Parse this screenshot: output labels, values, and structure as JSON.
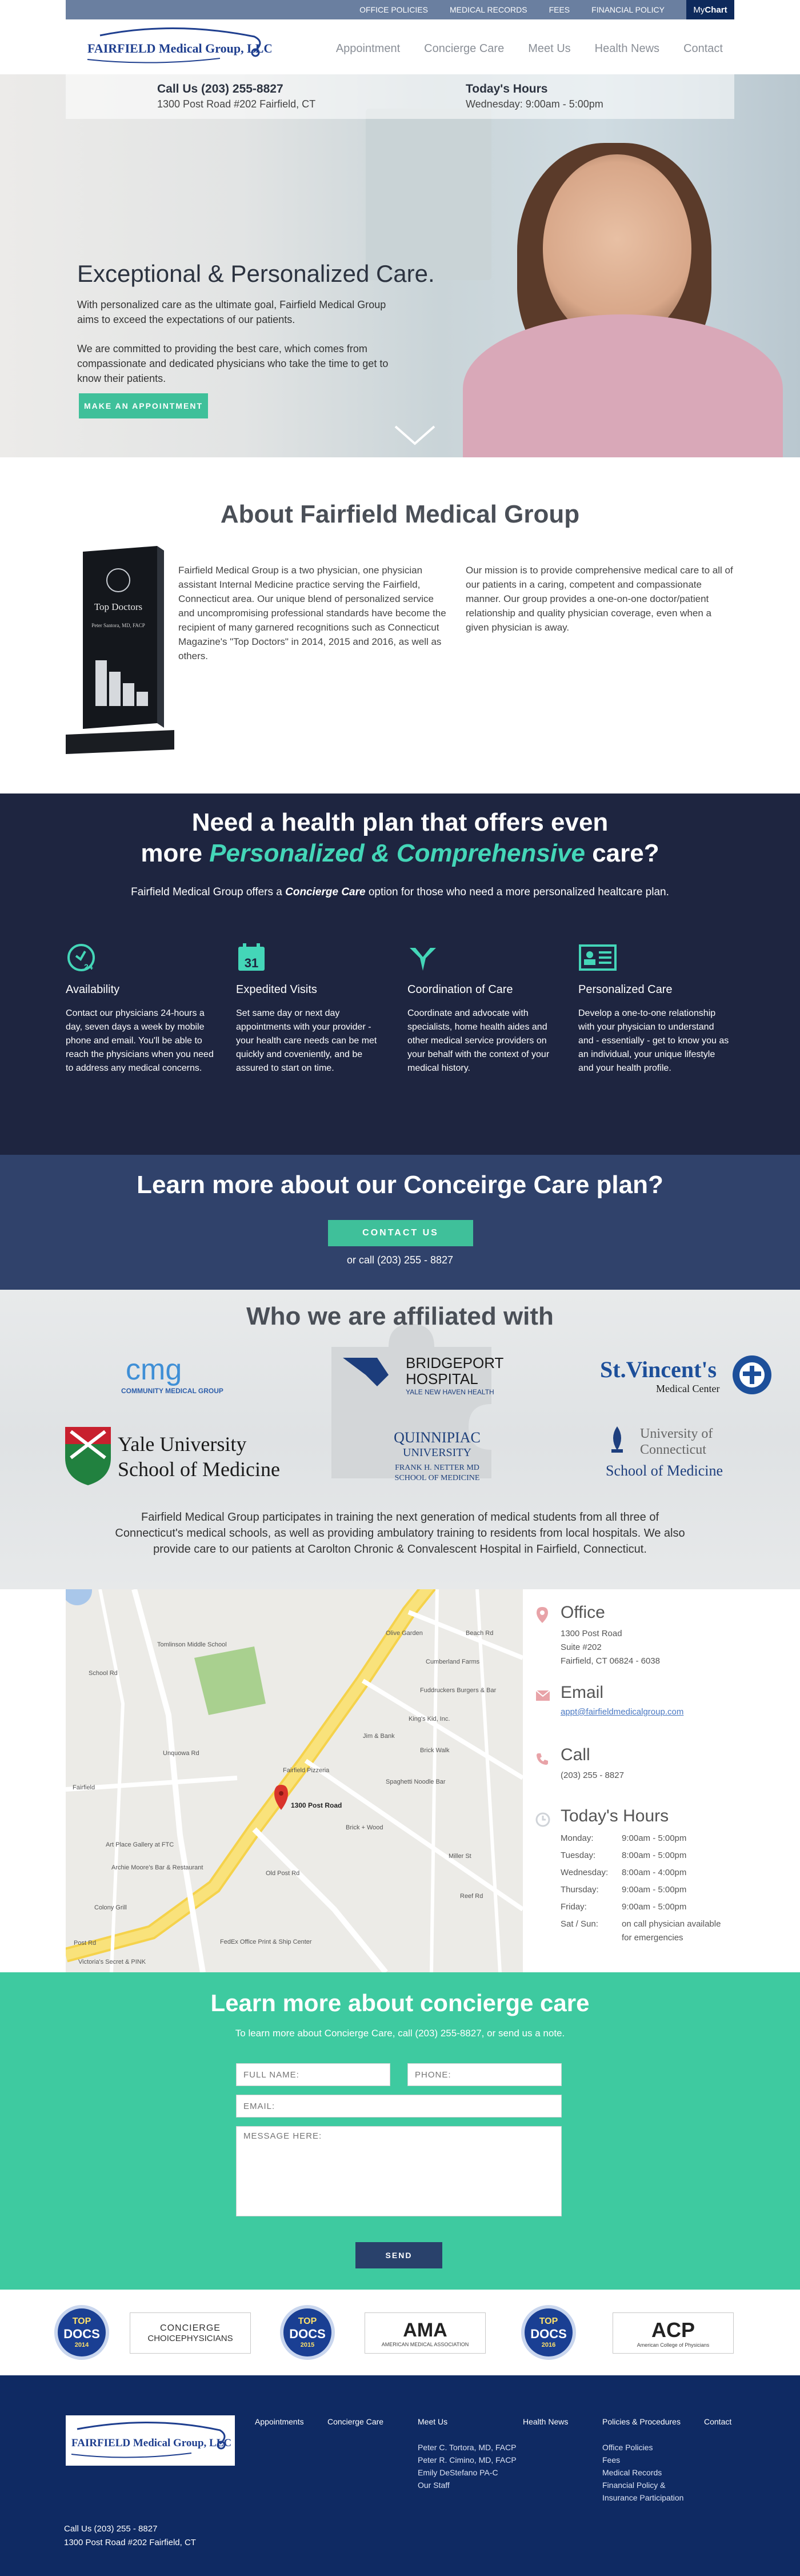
{
  "utility_bar": {
    "links": [
      "OFFICE POLICIES",
      "MEDICAL RECORDS",
      "FEES",
      "FINANCIAL POLICY"
    ],
    "mychart_prefix": "My",
    "mychart_bold": "Chart"
  },
  "header": {
    "logo_text": "FAIRFIELD Medical Group, LLC",
    "nav": [
      "Appointment",
      "Concierge Care",
      "Meet Us",
      "Health News",
      "Contact"
    ]
  },
  "hero": {
    "call_label": "Call Us (203) 255-8827",
    "address": "1300 Post Road #202 Fairfield, CT",
    "hours_label": "Today's Hours",
    "hours_value": "Wednesday: 9:00am - 5:00pm",
    "title": "Exceptional & Personalized Care.",
    "p1": "With personalized care as the ultimate goal, Fairfield Medical Group aims to exceed the expectations of our patients.",
    "p2": "We are committed to providing the best care, which comes from compassionate and dedicated physicians who take the time to get to know their patients.",
    "button": "MAKE AN APPOINTMENT",
    "chevron_icon": "chevron-down-icon"
  },
  "about": {
    "title": "About Fairfield Medical Group",
    "award_line1": "Top Doctors",
    "award_line2": "Peter Santora, MD, FACP",
    "left_text": "Fairfield Medical Group is a two physician, one physician assistant Internal Medicine practice serving the Fairfield, Connecticut area. Our unique blend of personalized service and uncompromising professional standards have become the recipient of many garnered recognitions such as Connecticut Magazine's \"Top Doctors\" in 2014, 2015 and 2016, as well as others.",
    "right_text": "Our mission is to provide comprehensive medical care to all of our patients in a caring, competent and compassionate manner. Our group provides a one-on-one doctor/patient relationship and quality physician coverage, even when a given physician is away."
  },
  "concierge": {
    "heading_line1": "Need a health plan that offers even",
    "heading_line2_pre": "more ",
    "heading_highlight": "Personalized & Comprehensive",
    "heading_line2_post": " care?",
    "sub_pre": "Fairfield Medical Group offers a ",
    "sub_bold": "Concierge Care",
    "sub_post": " option for those  who need a more personalized healtcare plan.",
    "features": [
      {
        "icon": "clock-24-icon",
        "title": "Availability",
        "desc": "Contact our physicians 24-hours a day, seven days a week by mobile phone and email. You'll be able to reach the physicians when you need to address any medical concerns."
      },
      {
        "icon": "calendar-icon",
        "title": "Expedited Visits",
        "desc": "Set same day or next day appointments with your provider - your health care needs can be met quickly and coveniently, and be assured to start on time."
      },
      {
        "icon": "merge-arrows-icon",
        "title": "Coordination of Care",
        "desc": "Coordinate and advocate with specialists, home health aides and other medical service providers on your behalf with the context of your medical history."
      },
      {
        "icon": "id-card-icon",
        "title": "Personalized Care",
        "desc": "Develop a one-to-one relationship with your physician to understand and - essentially - get to know you as an individual, your unique lifestyle and your health profile."
      }
    ],
    "accent": "#44d6b8"
  },
  "learn_more": {
    "title": "Learn more about our Conceirge Care plan?",
    "button": "CONTACT US",
    "call": "or call (203) 255 - 8827"
  },
  "affiliations": {
    "title": "Who we are affiliated with",
    "cmg_main": "cmg",
    "cmg_sub": "COMMUNITY MEDICAL GROUP",
    "bridgeport_1": "BRIDGEPORT",
    "bridgeport_2": "HOSPITAL",
    "bridgeport_3": "YALE NEW HAVEN HEALTH",
    "stv_1": "St.Vincent's",
    "stv_2": "Medical Center",
    "yale_1": "Yale University",
    "yale_2": "School of Medicine",
    "qu_1": "QUINNIPIAC",
    "qu_2": "UNIVERSITY",
    "qu_3": "FRANK H. NETTER MD",
    "qu_4": "SCHOOL OF MEDICINE",
    "uconn_1": "University of",
    "uconn_2": "Connecticut",
    "uconn_3": "School of Medicine",
    "text": "Fairfield Medical Group participates in training the next generation of medical students from all three of Connecticut's medical schools, as well as providing ambulatory training to residents from local hospitals. We also provide care to our patients at Carolton Chronic & Convalescent Hospital in Fairfield, Connecticut."
  },
  "map": {
    "pin_label": "1300 Post Road",
    "labels": {
      "tomlinson": "Tomlinson Middle School",
      "fairfield": "Fairfield",
      "art_place": "Art Place Gallery at FTC",
      "archie": "Archie Moore's Bar & Restaurant",
      "colony": "Colony Grill",
      "fedex": "FedEx Office Print & Ship Center",
      "victorias": "Victoria's Secret & PINK",
      "olive": "Olive Garden",
      "cumberland": "Cumberland Farms",
      "fuddruckers": "Fuddruckers Burgers & Bar",
      "kings": "King's Kid, Inc.",
      "jim": "Jim & Bank",
      "brick": "Brick Walk",
      "spaghetti": "Spaghetti Noodle Bar",
      "fairfield_pizza": "Fairfield Pizzeria",
      "brick_wood": "Brick + Wood",
      "post_rd": "Post Rd",
      "old_post_rd": "Old Post Rd",
      "reef_rd": "Reef Rd",
      "unquowa": "Unquowa Rd",
      "miller": "Miller St",
      "school_rd": "School Rd",
      "beach_rd": "Beach Rd"
    }
  },
  "info": {
    "office_title": "Office",
    "office_lines": [
      "1300 Post Road",
      "Suite #202",
      "Fairfield, CT 06824 - 6038"
    ],
    "email_title": "Email",
    "email": "appt@fairfieldmedicalgroup.com",
    "call_title": "Call",
    "phone": "(203) 255 - 8827",
    "hours_title": "Today's Hours",
    "hours": [
      {
        "day": "Monday:",
        "time": "9:00am - 5:00pm"
      },
      {
        "day": "Tuesday:",
        "time": "8:00am - 5:00pm"
      },
      {
        "day": "Wednesday:",
        "time": "8:00am - 4:00pm"
      },
      {
        "day": "Thursday:",
        "time": "9:00am - 5:00pm"
      },
      {
        "day": "Friday:",
        "time": "9:00am - 5:00pm"
      },
      {
        "day": "Sat / Sun:",
        "time": "on call physician available for emergencies"
      }
    ]
  },
  "form": {
    "title": "Learn more about concierge care",
    "sub": "To learn more about Concierge Care, call (203) 255-8827, or send us a note.",
    "name_ph": "FULL NAME:",
    "phone_ph": "PHONE:",
    "email_ph": "EMAIL:",
    "msg_ph": "MESSAGE HERE:",
    "send": "SEND"
  },
  "badges": {
    "topdocs_1": "TOP",
    "topdocs_2": "DOCS",
    "topdocs_year1": "2014",
    "topdocs_year2": "2015",
    "topdocs_year3": "2016",
    "concierge_1": "CONCIERGE",
    "concierge_2": "CHOICEPHYSICIANS",
    "ama": "AMA",
    "ama_sub": "AMERICAN MEDICAL ASSOCIATION",
    "acp": "ACP",
    "acp_sub": "American College of Physicians"
  },
  "footer": {
    "logo_text": "FAIRFIELD Medical Group, LLC",
    "contact_1": "Call Us (203) 255 - 8827",
    "contact_2": "1300 Post Road #202 Fairfield, CT",
    "cols": [
      {
        "h": "Appointments",
        "items": []
      },
      {
        "h": "Concierge Care",
        "items": []
      },
      {
        "h": "Meet Us",
        "items": [
          "Peter C. Tortora, MD, FACP",
          "Peter R. Cimino, MD, FACP",
          "Emily DeStefano PA-C",
          "Our Staff"
        ]
      },
      {
        "h": "Health News",
        "items": []
      },
      {
        "h": "Policies & Procedures",
        "items": [
          "Office Policies",
          "Fees",
          "Medical Records",
          "Financial Policy & Insurance Participation"
        ]
      },
      {
        "h": "Contact",
        "items": []
      }
    ]
  }
}
